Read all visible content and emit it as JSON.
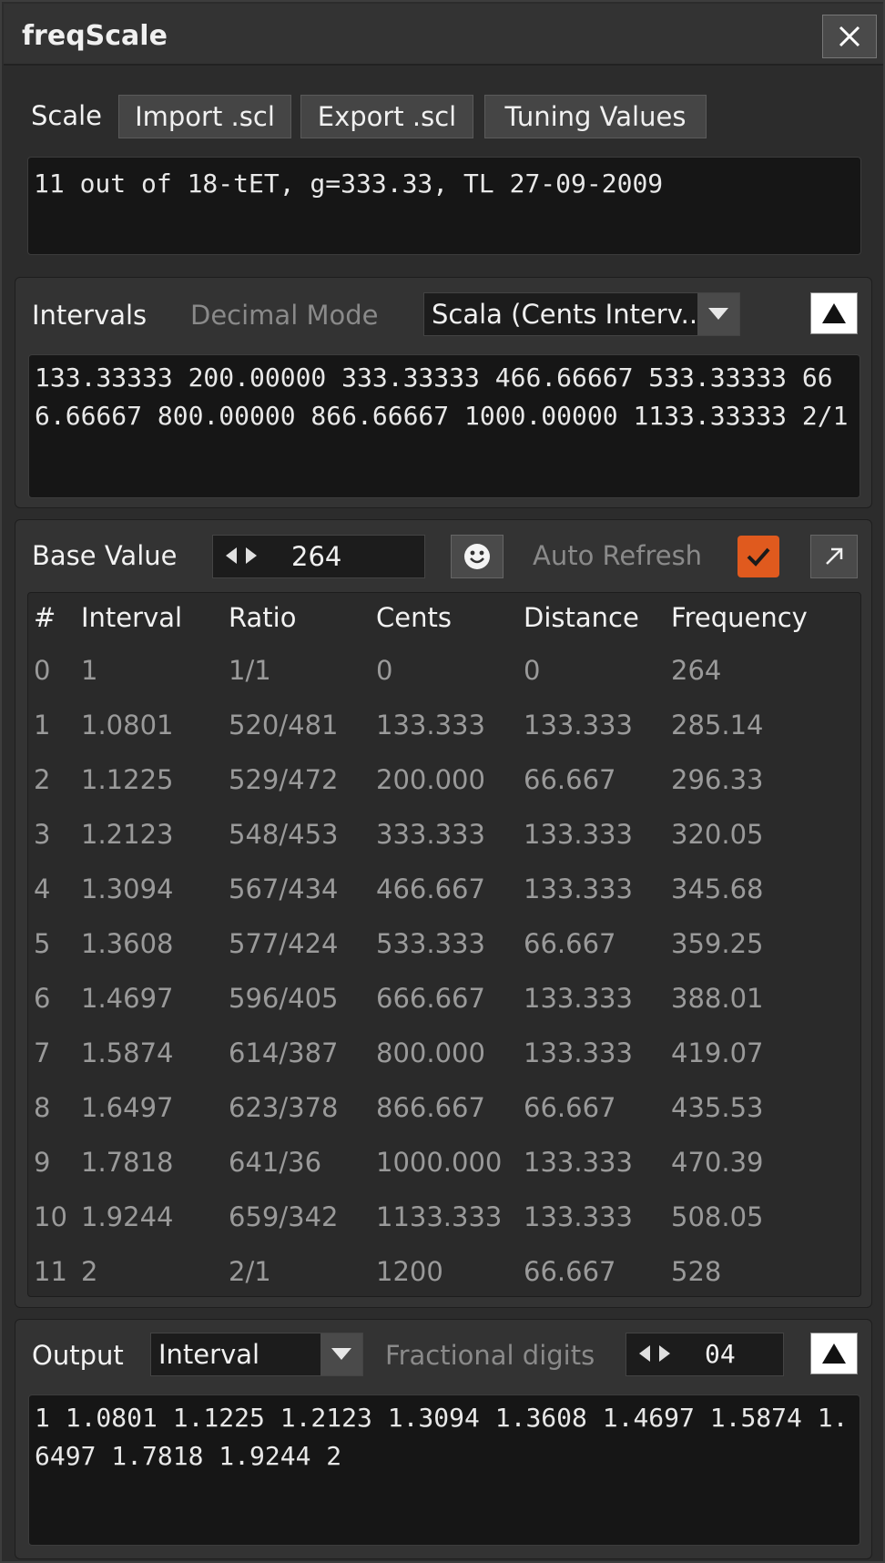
{
  "window": {
    "title": "freqScale"
  },
  "scale": {
    "label": "Scale",
    "import_label": "Import .scl",
    "export_label": "Export .scl",
    "tuning_label": "Tuning Values",
    "description": "11 out of 18-tET, g=333.33, TL 27-09-2009"
  },
  "intervals": {
    "label": "Intervals",
    "decimal_mode_label": "Decimal Mode",
    "format_selected": "Scala (Cents Interv..",
    "text": "133.33333 200.00000 333.33333 466.66667 533.33333 666.66667 800.00000 866.66667 1000.00000 1133.33333 2/1"
  },
  "base": {
    "label": "Base Value",
    "value": "264",
    "auto_refresh_label": "Auto Refresh",
    "auto_refresh_checked": true,
    "accent_color": "#e05a1e"
  },
  "table": {
    "headers": [
      "#",
      "Interval",
      "Ratio",
      "Cents",
      "Distance",
      "Frequency"
    ],
    "rows": [
      [
        "0",
        "1",
        "1/1",
        "0",
        "0",
        "264"
      ],
      [
        "1",
        "1.0801",
        "520/481",
        "133.333",
        "133.333",
        "285.14"
      ],
      [
        "2",
        "1.1225",
        "529/472",
        "200.000",
        "66.667",
        "296.33"
      ],
      [
        "3",
        "1.2123",
        "548/453",
        "333.333",
        "133.333",
        "320.05"
      ],
      [
        "4",
        "1.3094",
        "567/434",
        "466.667",
        "133.333",
        "345.68"
      ],
      [
        "5",
        "1.3608",
        "577/424",
        "533.333",
        "66.667",
        "359.25"
      ],
      [
        "6",
        "1.4697",
        "596/405",
        "666.667",
        "133.333",
        "388.01"
      ],
      [
        "7",
        "1.5874",
        "614/387",
        "800.000",
        "133.333",
        "419.07"
      ],
      [
        "8",
        "1.6497",
        "623/378",
        "866.667",
        "66.667",
        "435.53"
      ],
      [
        "9",
        "1.7818",
        "641/36",
        "1000.000",
        "133.333",
        "470.39"
      ],
      [
        "10",
        "1.9244",
        "659/342",
        "1133.333",
        "133.333",
        "508.05"
      ],
      [
        "11",
        "2",
        "2/1",
        "1200",
        "66.667",
        "528"
      ]
    ]
  },
  "output": {
    "label": "Output",
    "mode_selected": "Interval",
    "fractional_label": "Fractional digits",
    "fractional_value": "04",
    "text": "1 1.0801 1.1225 1.2123 1.3094 1.3608 1.4697 1.5874 1.6497 1.7818 1.9244 2"
  }
}
